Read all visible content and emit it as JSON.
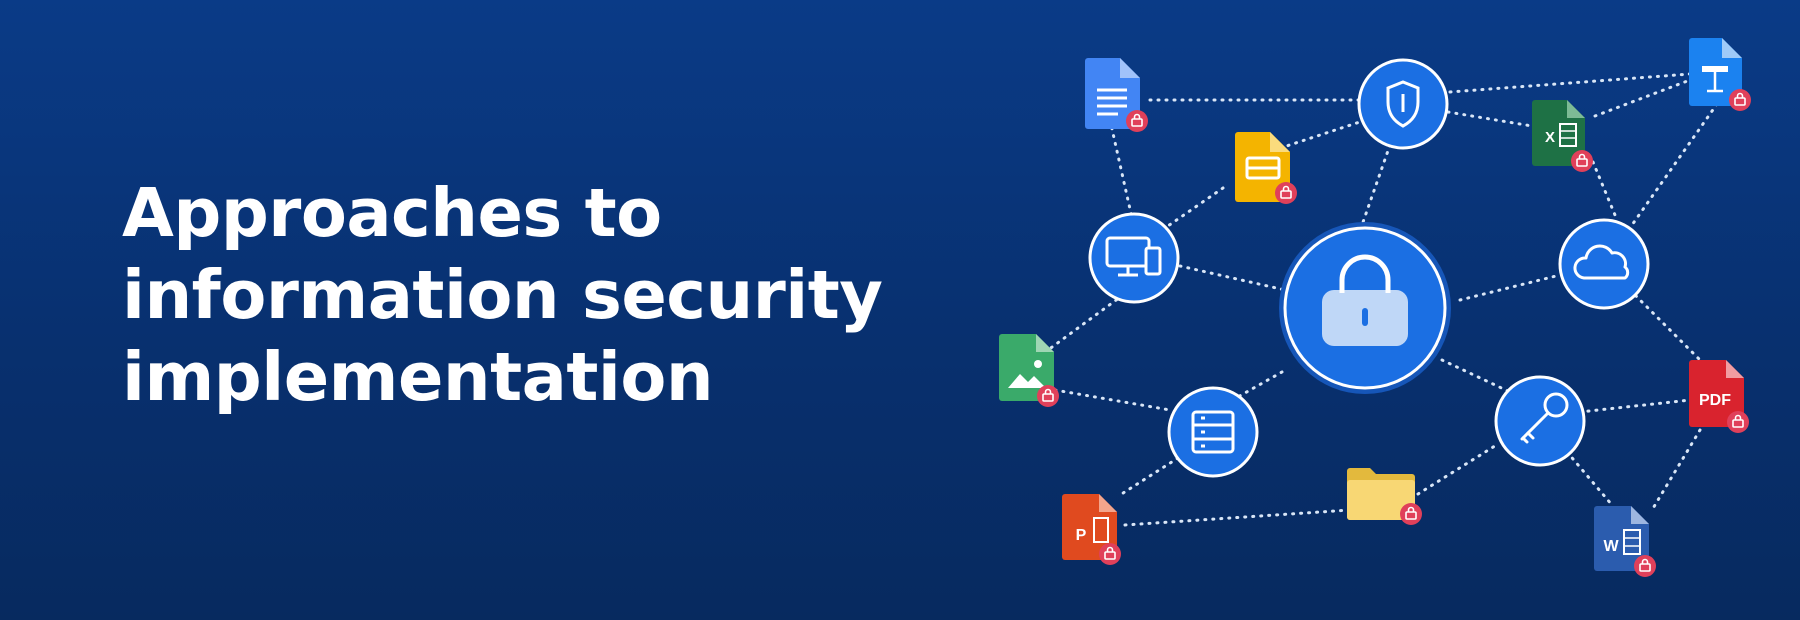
{
  "headline": {
    "lines": [
      "Approaches to",
      "information security",
      "implementation"
    ]
  },
  "colors": {
    "background": "#083070",
    "hub": "#1b6fe3",
    "hub_stroke": "#ffffff",
    "connector": "#d9e6f7",
    "lock_badge": "#e0405a"
  },
  "network": {
    "hubs": [
      {
        "name": "lock-icon"
      },
      {
        "name": "shield-icon"
      },
      {
        "name": "devices-icon"
      },
      {
        "name": "cloud-icon"
      },
      {
        "name": "server-icon"
      },
      {
        "name": "key-icon"
      }
    ],
    "files": [
      {
        "name": "google-docs-file-icon"
      },
      {
        "name": "google-slides-file-icon"
      },
      {
        "name": "excel-file-icon",
        "label": "X"
      },
      {
        "name": "keynote-file-icon"
      },
      {
        "name": "image-file-icon"
      },
      {
        "name": "pdf-file-icon",
        "label": "PDF"
      },
      {
        "name": "powerpoint-file-icon",
        "label": "P"
      },
      {
        "name": "folder-icon"
      },
      {
        "name": "word-file-icon",
        "label": "W"
      }
    ]
  }
}
